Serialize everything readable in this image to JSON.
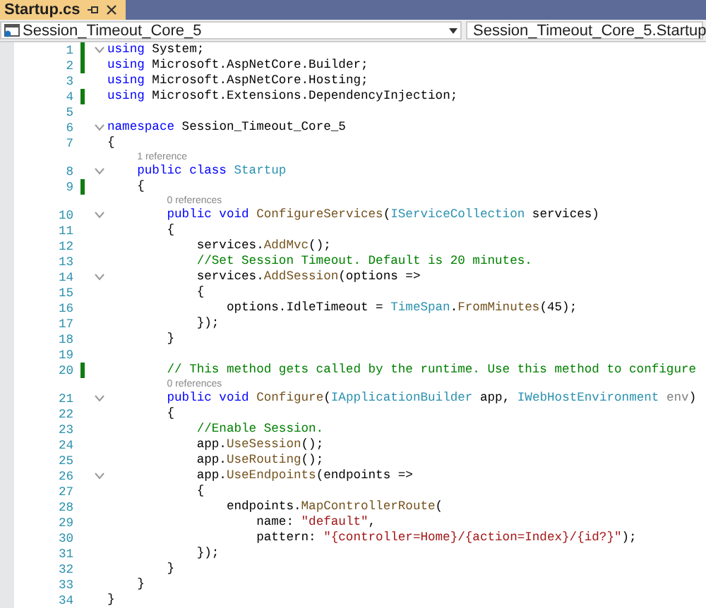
{
  "tab": {
    "title": "Startup.cs"
  },
  "navigation": {
    "project": "Session_Timeout_Core_5",
    "type": "Session_Timeout_Core_5.Startup"
  },
  "lines": [
    {
      "kind": "code",
      "number": "1",
      "changed": true,
      "foldable": true,
      "tokens": [
        {
          "kind": "keyword",
          "t": "using"
        },
        {
          "kind": "plain",
          "t": " System;"
        }
      ]
    },
    {
      "kind": "code",
      "number": "2",
      "changed": true,
      "foldable": false,
      "tokens": [
        {
          "kind": "keyword",
          "t": "using"
        },
        {
          "kind": "plain",
          "t": " Microsoft.AspNetCore.Builder;"
        }
      ]
    },
    {
      "kind": "code",
      "number": "3",
      "changed": false,
      "foldable": false,
      "tokens": [
        {
          "kind": "keyword",
          "t": "using"
        },
        {
          "kind": "plain",
          "t": " Microsoft.AspNetCore.Hosting;"
        }
      ]
    },
    {
      "kind": "code",
      "number": "4",
      "changed": true,
      "foldable": false,
      "tokens": [
        {
          "kind": "keyword",
          "t": "using"
        },
        {
          "kind": "plain",
          "t": " Microsoft.Extensions.DependencyInjection;"
        }
      ]
    },
    {
      "kind": "code",
      "number": "5",
      "changed": false,
      "foldable": false
    },
    {
      "kind": "code",
      "number": "6",
      "changed": false,
      "foldable": true,
      "tokens": [
        {
          "kind": "keyword",
          "t": "namespace"
        },
        {
          "kind": "plain",
          "t": " Session_Timeout_Core_5"
        }
      ]
    },
    {
      "kind": "code",
      "number": "7",
      "changed": false,
      "foldable": false,
      "tokens": [
        {
          "kind": "plain",
          "t": "{"
        }
      ]
    },
    {
      "kind": "lens",
      "text": "1 reference"
    },
    {
      "kind": "code",
      "number": "8",
      "changed": false,
      "foldable": true,
      "tokens": [
        {
          "kind": "keyword",
          "t": "    public class"
        },
        {
          "kind": "type",
          "t": " Startup"
        }
      ]
    },
    {
      "kind": "code",
      "number": "9",
      "changed": true,
      "foldable": false,
      "tokens": [
        {
          "kind": "plain",
          "t": "    {"
        }
      ]
    },
    {
      "kind": "lens",
      "text": "0 references"
    },
    {
      "kind": "code",
      "number": "10",
      "changed": false,
      "foldable": true,
      "tokens": [
        {
          "kind": "keyword",
          "t": "        public void"
        },
        {
          "kind": "method",
          "t": " ConfigureServices"
        },
        {
          "kind": "plain",
          "t": "("
        },
        {
          "kind": "type",
          "t": "IServiceCollection"
        },
        {
          "kind": "plain",
          "t": " services)"
        }
      ]
    },
    {
      "kind": "code",
      "number": "11",
      "changed": false,
      "foldable": false,
      "tokens": [
        {
          "kind": "plain",
          "t": "        {"
        }
      ]
    },
    {
      "kind": "code",
      "number": "12",
      "changed": false,
      "foldable": false,
      "tokens": [
        {
          "kind": "plain",
          "t": "            services."
        },
        {
          "kind": "method",
          "t": "AddMvc"
        },
        {
          "kind": "plain",
          "t": "();"
        }
      ]
    },
    {
      "kind": "code",
      "number": "13",
      "changed": false,
      "foldable": false,
      "tokens": [
        {
          "kind": "comment",
          "t": "            //Set Session Timeout. Default is 20 minutes."
        }
      ]
    },
    {
      "kind": "code",
      "number": "14",
      "changed": false,
      "foldable": true,
      "tokens": [
        {
          "kind": "plain",
          "t": "            services."
        },
        {
          "kind": "method",
          "t": "AddSession"
        },
        {
          "kind": "plain",
          "t": "(options =>"
        }
      ]
    },
    {
      "kind": "code",
      "number": "15",
      "changed": false,
      "foldable": false,
      "tokens": [
        {
          "kind": "plain",
          "t": "            {"
        }
      ]
    },
    {
      "kind": "code",
      "number": "16",
      "changed": false,
      "foldable": false,
      "tokens": [
        {
          "kind": "plain",
          "t": "                options.IdleTimeout = "
        },
        {
          "kind": "type",
          "t": "TimeSpan"
        },
        {
          "kind": "plain",
          "t": "."
        },
        {
          "kind": "method",
          "t": "FromMinutes"
        },
        {
          "kind": "plain",
          "t": "(45);"
        }
      ]
    },
    {
      "kind": "code",
      "number": "17",
      "changed": false,
      "foldable": false,
      "tokens": [
        {
          "kind": "plain",
          "t": "            });"
        }
      ]
    },
    {
      "kind": "code",
      "number": "18",
      "changed": false,
      "foldable": false,
      "tokens": [
        {
          "kind": "plain",
          "t": "        }"
        }
      ]
    },
    {
      "kind": "code",
      "number": "19",
      "changed": false,
      "foldable": false
    },
    {
      "kind": "code",
      "number": "20",
      "changed": true,
      "foldable": false,
      "tokens": [
        {
          "kind": "comment",
          "t": "        // This method gets called by the runtime. Use this method to configure"
        }
      ]
    },
    {
      "kind": "lens",
      "text": "0 references"
    },
    {
      "kind": "code",
      "number": "21",
      "changed": false,
      "foldable": true,
      "tokens": [
        {
          "kind": "keyword",
          "t": "        public void"
        },
        {
          "kind": "method",
          "t": " Configure"
        },
        {
          "kind": "plain",
          "t": "("
        },
        {
          "kind": "type",
          "t": "IApplicationBuilder"
        },
        {
          "kind": "plain",
          "t": " app, "
        },
        {
          "kind": "type",
          "t": "IWebHostEnvironment"
        },
        {
          "kind": "unused",
          "t": " env"
        },
        {
          "kind": "plain",
          "t": ")"
        }
      ]
    },
    {
      "kind": "code",
      "number": "22",
      "changed": false,
      "foldable": false,
      "tokens": [
        {
          "kind": "plain",
          "t": "        {"
        }
      ]
    },
    {
      "kind": "code",
      "number": "23",
      "changed": false,
      "foldable": false,
      "tokens": [
        {
          "kind": "comment",
          "t": "            //Enable Session."
        }
      ]
    },
    {
      "kind": "code",
      "number": "24",
      "changed": false,
      "foldable": false,
      "tokens": [
        {
          "kind": "plain",
          "t": "            app."
        },
        {
          "kind": "method",
          "t": "UseSession"
        },
        {
          "kind": "plain",
          "t": "();"
        }
      ]
    },
    {
      "kind": "code",
      "number": "25",
      "changed": false,
      "foldable": false,
      "tokens": [
        {
          "kind": "plain",
          "t": "            app."
        },
        {
          "kind": "method",
          "t": "UseRouting"
        },
        {
          "kind": "plain",
          "t": "();"
        }
      ]
    },
    {
      "kind": "code",
      "number": "26",
      "changed": false,
      "foldable": true,
      "tokens": [
        {
          "kind": "plain",
          "t": "            app."
        },
        {
          "kind": "method",
          "t": "UseEndpoints"
        },
        {
          "kind": "plain",
          "t": "(endpoints =>"
        }
      ]
    },
    {
      "kind": "code",
      "number": "27",
      "changed": false,
      "foldable": false,
      "tokens": [
        {
          "kind": "plain",
          "t": "            {"
        }
      ]
    },
    {
      "kind": "code",
      "number": "28",
      "changed": false,
      "foldable": false,
      "tokens": [
        {
          "kind": "plain",
          "t": "                endpoints."
        },
        {
          "kind": "method",
          "t": "MapControllerRoute"
        },
        {
          "kind": "plain",
          "t": "("
        }
      ]
    },
    {
      "kind": "code",
      "number": "29",
      "changed": false,
      "foldable": false,
      "tokens": [
        {
          "kind": "plain",
          "t": "                    name: "
        },
        {
          "kind": "string",
          "t": "\"default\""
        },
        {
          "kind": "plain",
          "t": ","
        }
      ]
    },
    {
      "kind": "code",
      "number": "30",
      "changed": false,
      "foldable": false,
      "tokens": [
        {
          "kind": "plain",
          "t": "                    pattern: "
        },
        {
          "kind": "string",
          "t": "\"{controller=Home}/{action=Index}/{id?}\""
        },
        {
          "kind": "plain",
          "t": ");"
        }
      ]
    },
    {
      "kind": "code",
      "number": "31",
      "changed": false,
      "foldable": false,
      "tokens": [
        {
          "kind": "plain",
          "t": "            });"
        }
      ]
    },
    {
      "kind": "code",
      "number": "32",
      "changed": false,
      "foldable": false,
      "tokens": [
        {
          "kind": "plain",
          "t": "        }"
        }
      ]
    },
    {
      "kind": "code",
      "number": "33",
      "changed": false,
      "foldable": false,
      "tokens": [
        {
          "kind": "plain",
          "t": "    }"
        }
      ]
    },
    {
      "kind": "code",
      "number": "34",
      "changed": false,
      "foldable": false,
      "tokens": [
        {
          "kind": "plain",
          "t": "}"
        }
      ]
    }
  ]
}
